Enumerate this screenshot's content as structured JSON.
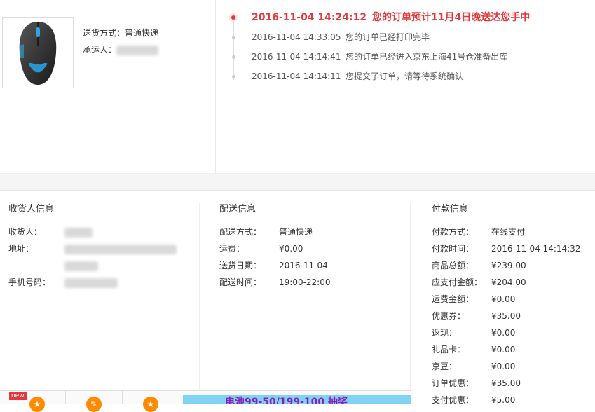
{
  "delivery": {
    "method_label": "送货方式：",
    "method_value": "普通快递",
    "carrier_label": "承运人："
  },
  "timeline": [
    {
      "time": "2016-11-04 14:24:12",
      "msg": "您的订单预计11月4日晚送达您手中"
    },
    {
      "time": "2016-11-04 14:33:05",
      "msg": "您的订单已经打印完毕"
    },
    {
      "time": "2016-11-04 14:14:41",
      "msg": "您的订单已经进入京东上海41号仓准备出库"
    },
    {
      "time": "2016-11-04 14:14:11",
      "msg": "您提交了订单，请等待系统确认"
    }
  ],
  "receiver": {
    "title": "收货人信息",
    "name_label": "收货人：",
    "address_label": "地址：",
    "phone_label": "手机号码："
  },
  "shipping": {
    "title": "配送信息",
    "rows": [
      {
        "k": "配送方式：",
        "v": "普通快递"
      },
      {
        "k": "运费：",
        "v": "¥0.00"
      },
      {
        "k": "送货日期：",
        "v": "2016-11-04"
      },
      {
        "k": "配送时间：",
        "v": "19:00-22:00"
      }
    ]
  },
  "payment": {
    "title": "付款信息",
    "rows": [
      {
        "k": "付款方式：",
        "v": "在线支付"
      },
      {
        "k": "付款时间：",
        "v": "2016-11-04 14:14:32"
      },
      {
        "k": "商品总额：",
        "v": "¥239.00"
      },
      {
        "k": "应支付金额：",
        "v": "¥204.00"
      },
      {
        "k": "运费金额：",
        "v": "¥0.00"
      },
      {
        "k": "优惠券：",
        "v": "¥35.00"
      },
      {
        "k": "返现：",
        "v": "¥0.00"
      },
      {
        "k": "礼品卡：",
        "v": "¥0.00"
      },
      {
        "k": "京豆：",
        "v": "¥0.00"
      },
      {
        "k": "订单优惠：",
        "v": "¥35.00"
      },
      {
        "k": "支付优惠：",
        "v": "¥5.00"
      }
    ]
  },
  "footer": {
    "new_tag": "new",
    "banner_text": "电池99-50/199-100 抽奖",
    "icons": [
      "star-icon",
      "coupon-icon",
      "favorite-icon"
    ]
  },
  "colors": {
    "accent": "#e4393c",
    "banner_bg": "#7fd3f5",
    "banner_text": "#8a1fb8"
  }
}
